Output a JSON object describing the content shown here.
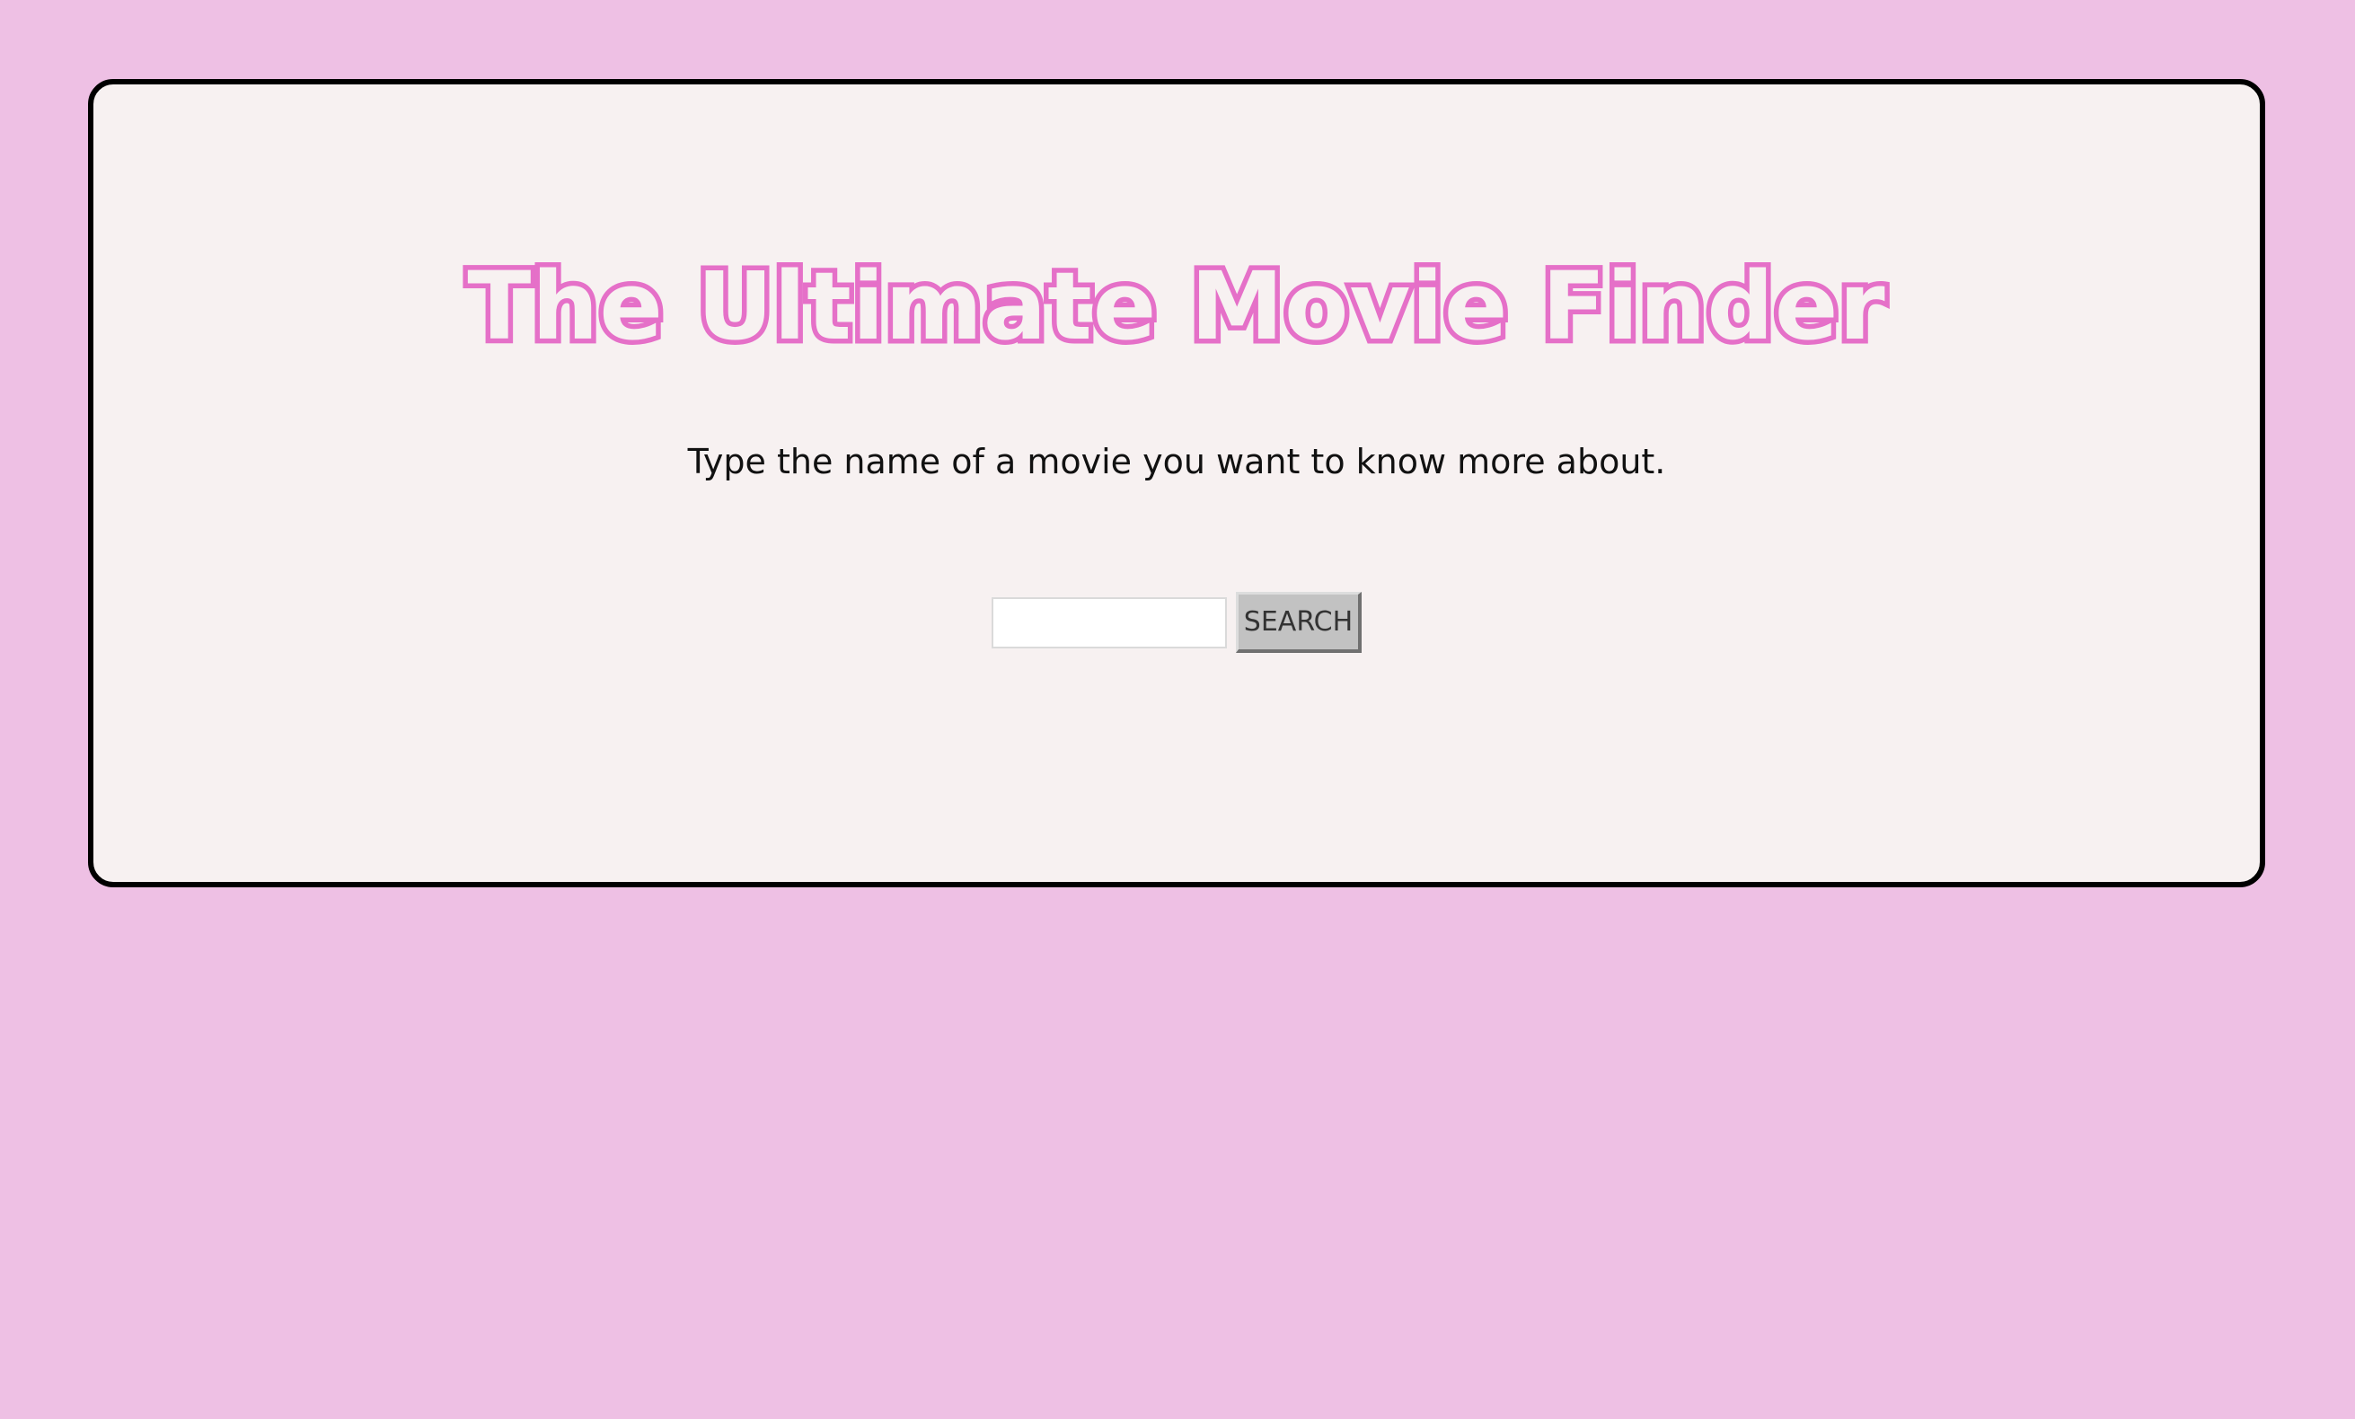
{
  "page": {
    "background_color": "#EEC0E4",
    "card_color": "#F7F1F1",
    "accent_color": "#E570C8"
  },
  "header": {
    "title": "The Ultimate Movie Finder",
    "subtitle": "Type the name of a movie you want to know more about."
  },
  "search": {
    "input_value": "",
    "input_placeholder": "",
    "button_label": "SEARCH"
  }
}
